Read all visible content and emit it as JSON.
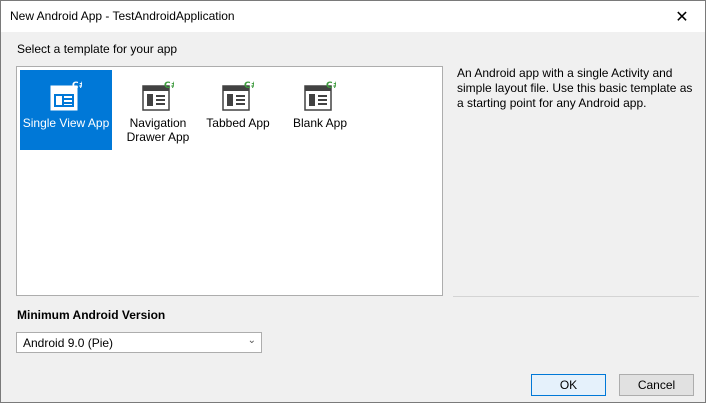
{
  "window": {
    "title": "New Android App - TestAndroidApplication",
    "close_glyph": "✕"
  },
  "templates": {
    "heading": "Select a template for your app",
    "items": [
      {
        "label": "Single View App",
        "selected": true,
        "icon": "single-view-icon"
      },
      {
        "label": "Navigation Drawer App",
        "selected": false,
        "icon": "navigation-drawer-icon"
      },
      {
        "label": "Tabbed App",
        "selected": false,
        "icon": "tabbed-icon"
      },
      {
        "label": "Blank App",
        "selected": false,
        "icon": "blank-icon"
      }
    ]
  },
  "description": "An Android app with a single Activity and simple layout file. Use this basic template as a starting point for any Android app.",
  "min_version": {
    "label": "Minimum Android Version",
    "selected": "Android 9.0 (Pie)",
    "arrow": "⌄"
  },
  "buttons": {
    "ok": "OK",
    "cancel": "Cancel"
  },
  "colors": {
    "selection": "#0078d7",
    "icon_badge": "#3c9a3c"
  }
}
